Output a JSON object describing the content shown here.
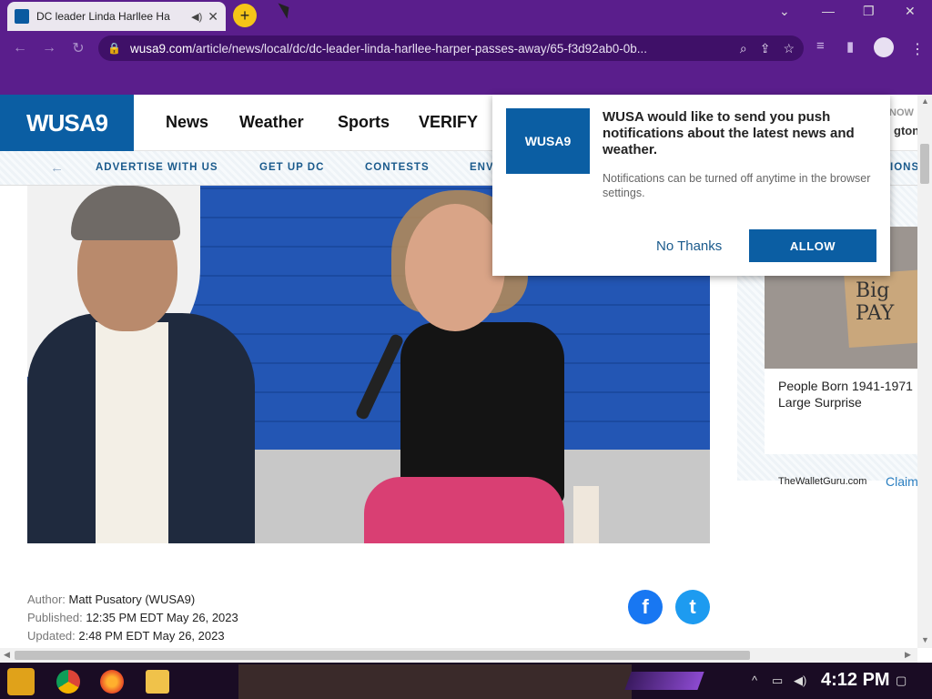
{
  "browser": {
    "tab_title": "DC leader Linda Harllee Ha",
    "tab_audio_icon": "speaker-icon",
    "close_glyph": "✕",
    "new_tab_glyph": "+",
    "url_host": "wusa9.com",
    "url_path": "/article/news/local/dc/dc-leader-linda-harllee-harper-passes-away/65-f3d92ab0-0b...",
    "win_min": "—",
    "win_restore": "❐",
    "win_close": "✕",
    "win_down": "⌄"
  },
  "site": {
    "logo": "WUSA9",
    "nav": [
      "News",
      "Weather",
      "Sports",
      "VERIFY"
    ],
    "now_label": "NOW",
    "now_place": "gton",
    "subnav": [
      "ADVERTISE WITH US",
      "GET UP DC",
      "CONTESTS",
      "ENV",
      "IONS"
    ]
  },
  "article": {
    "author_label": "Author:",
    "author": "Matt Pusatory (WUSA9)",
    "published_label": "Published:",
    "published": "12:35 PM EDT May 26, 2023",
    "updated_label": "Updated:",
    "updated": "2:48 PM EDT May 26, 2023",
    "facebook_glyph": "f",
    "twitter_glyph": "t"
  },
  "ad": {
    "sign_text": "Big PAY",
    "text": "People Born 1941-1971 Large Surprise",
    "source": "TheWalletGuru.com",
    "cta": "Claim"
  },
  "notification": {
    "logo": "WUSA9",
    "title": "WUSA would like to send you push notifications about the latest news and weather.",
    "subtitle": "Notifications can be turned off anytime in the browser settings.",
    "decline": "No Thanks",
    "accept": "ALLOW"
  },
  "taskbar": {
    "clock": "4:12 PM"
  }
}
